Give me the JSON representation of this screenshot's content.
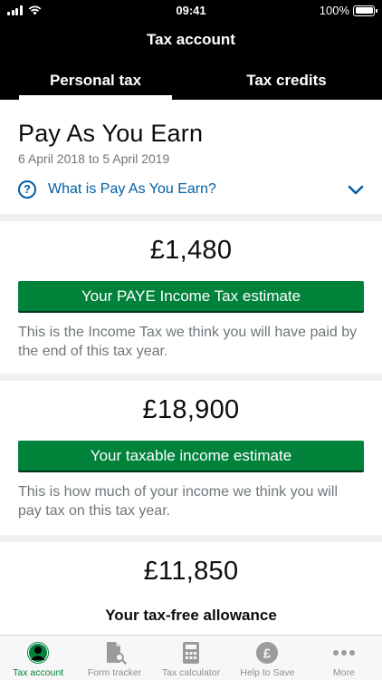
{
  "status_bar": {
    "time": "09:41",
    "battery": "100%"
  },
  "header": {
    "title": "Tax account",
    "tabs": [
      {
        "label": "Personal tax",
        "active": true
      },
      {
        "label": "Tax credits",
        "active": false
      }
    ]
  },
  "intro": {
    "title": "Pay As You Earn",
    "dates": "6 April 2018 to 5 April 2019",
    "help_link": "What is Pay As You Earn?"
  },
  "cards": [
    {
      "amount": "£1,480",
      "button": "Your PAYE Income Tax estimate",
      "description": "This is the Income Tax we think you will have paid by the end of this tax year."
    },
    {
      "amount": "£18,900",
      "button": "Your taxable income estimate",
      "description": "This is how much of your income we think you will pay tax on this tax year."
    },
    {
      "amount": "£11,850",
      "label": "Your tax-free allowance"
    }
  ],
  "tab_bar": [
    {
      "label": "Tax account",
      "icon": "person-icon",
      "active": true
    },
    {
      "label": "Form tracker",
      "icon": "form-search-icon",
      "active": false
    },
    {
      "label": "Tax calculator",
      "icon": "calculator-icon",
      "active": false
    },
    {
      "label": "Help to Save",
      "icon": "pound-coin-icon",
      "active": false
    },
    {
      "label": "More",
      "icon": "more-dots-icon",
      "active": false
    }
  ],
  "colors": {
    "accent_green": "#00823b",
    "link_blue": "#005ea5",
    "header_bg": "#000000"
  }
}
